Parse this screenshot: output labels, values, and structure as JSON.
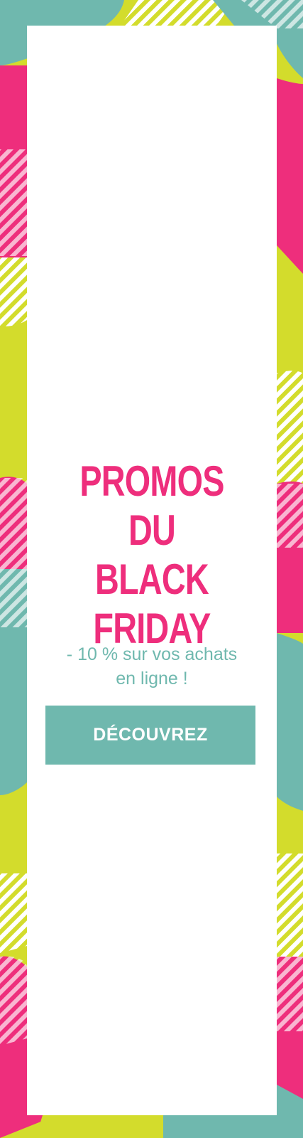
{
  "banner": {
    "headline": [
      "PROMOS DU",
      "BLACK",
      "FRIDAY"
    ],
    "subtitle": [
      "- 10 % sur vos achats",
      "en ligne !"
    ],
    "cta_label": "DÉCOUVREZ"
  },
  "colors": {
    "pink": "#ee2e7c",
    "teal": "#6fb8ae",
    "lime": "#d3dc2c",
    "white": "#ffffff"
  }
}
